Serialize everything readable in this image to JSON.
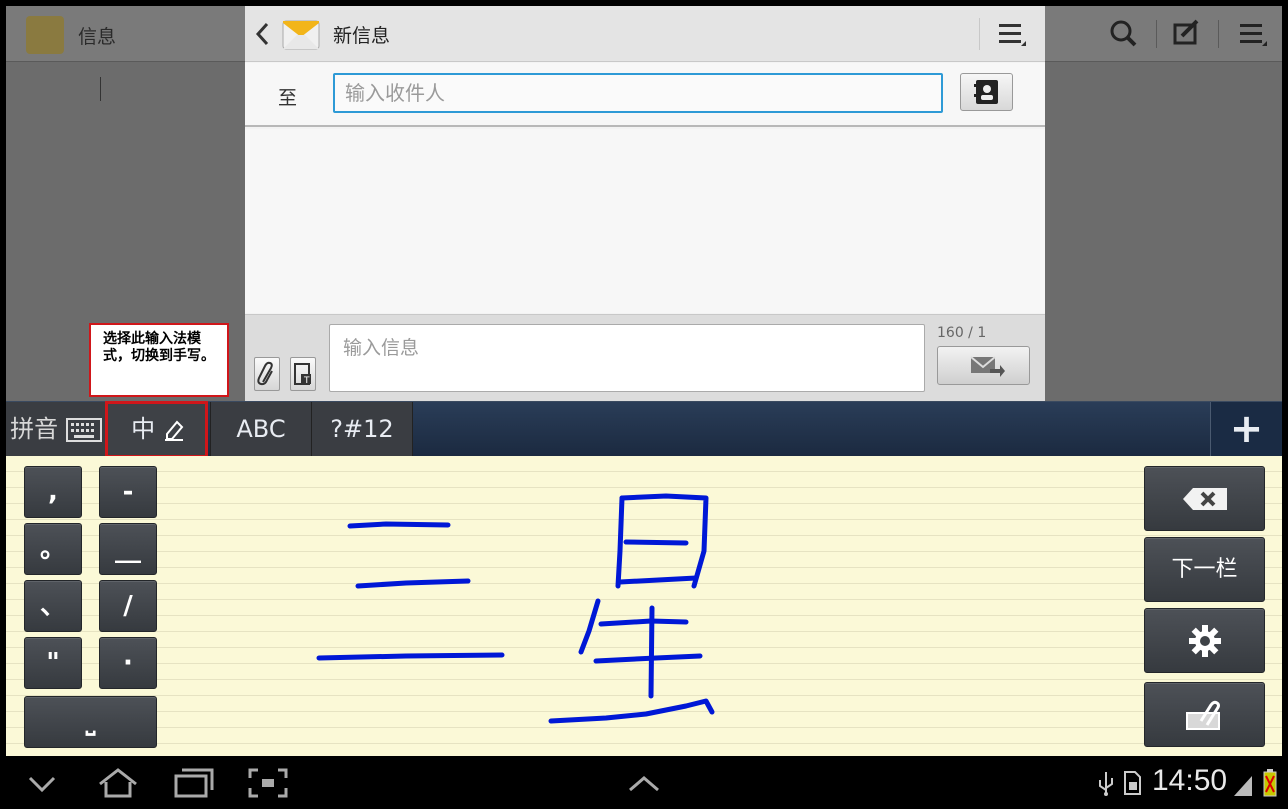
{
  "background_app": {
    "title": "信息"
  },
  "dialog": {
    "title": "新信息",
    "to_label": "至",
    "recipient_placeholder": "输入收件人",
    "message_placeholder": "输入信息",
    "char_counter": "160 / 1"
  },
  "annotation": {
    "text": "选择此输入法模式，切换到手写。"
  },
  "ime": {
    "tabs": [
      "拼音",
      "中",
      "ABC",
      "?#12"
    ],
    "plus": "+",
    "symbols_left": [
      ",",
      "。",
      "、",
      "\""
    ],
    "symbols_right": [
      "-",
      "__",
      "/",
      "·"
    ],
    "space_key": "⎵",
    "next_column": "下一栏",
    "handwritten_chars": [
      "三",
      "星"
    ],
    "stroke_color": "#0018d6"
  },
  "status_bar": {
    "time": "14:50"
  },
  "colors": {
    "accent_blue": "#2e9ad6",
    "highlight_red": "#d0161a",
    "pad_yellow": "#fbf9d7"
  }
}
